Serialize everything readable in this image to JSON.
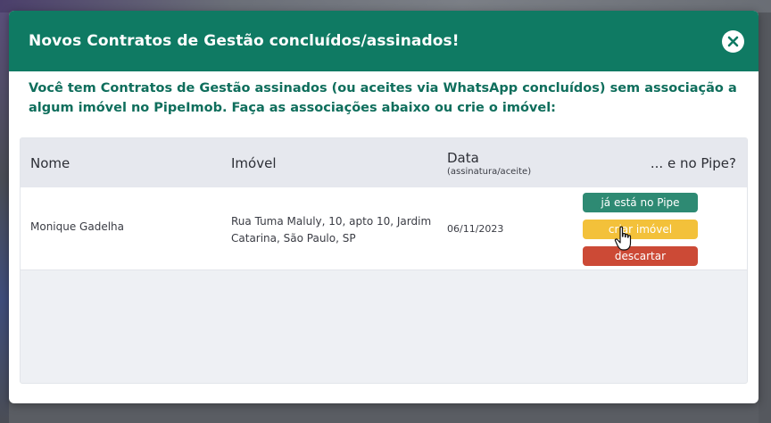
{
  "modal": {
    "title": "Novos Contratos de Gestão concluídos/assinados!",
    "intro": "Você tem Contratos de Gestão assinados (ou aceites via WhatsApp concluídos) sem associação a algum imóvel no PipeImob. Faça as associações abaixo ou crie o imóvel:"
  },
  "table": {
    "columns": {
      "nome": "Nome",
      "imovel": "Imóvel",
      "data": "Data",
      "data_sub": "(assinatura/aceite)",
      "pipe": "... e no Pipe?"
    },
    "rows": [
      {
        "nome": "Monique Gadelha",
        "imovel": "Rua Tuma Maluly, 10, apto 10, Jardim Catarina, São Paulo, SP",
        "data": "06/11/2023",
        "actions": {
          "ja_esta": "já está no Pipe",
          "criar": "criar imóvel",
          "descartar": "descartar"
        }
      }
    ]
  },
  "colors": {
    "header_bg": "#0f7a63",
    "intro_text": "#0f6e5c",
    "btn_ja_esta": "#2e8a73",
    "btn_criar": "#f3c13a",
    "btn_descartar": "#cc4a36"
  },
  "icons": {
    "close": "close-icon",
    "cursor": "hand-pointer-icon"
  }
}
